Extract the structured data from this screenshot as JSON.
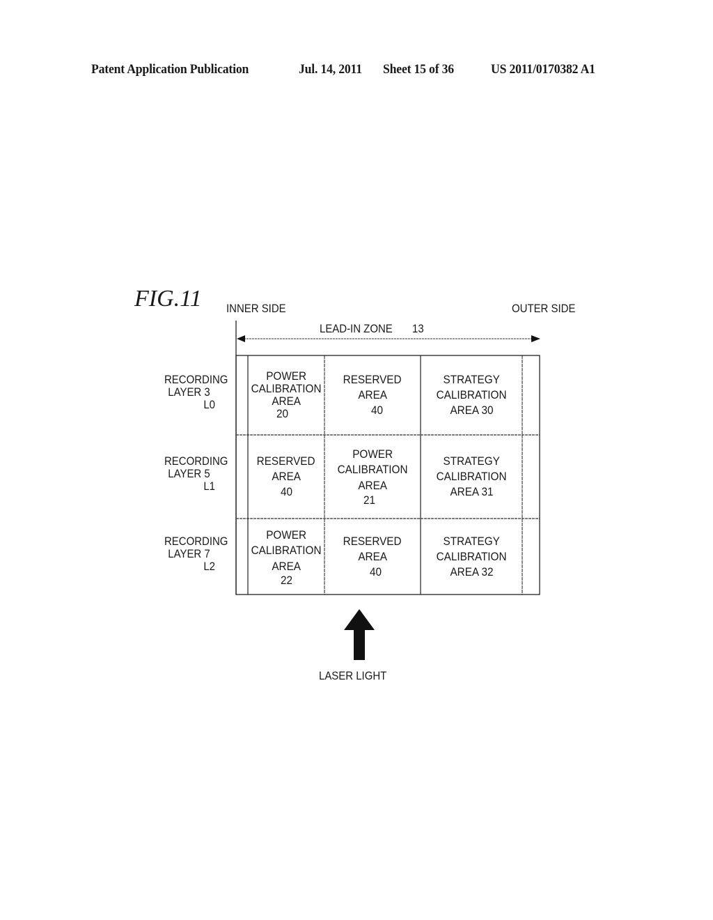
{
  "header": {
    "publication": "Patent Application Publication",
    "date": "Jul. 14, 2011",
    "sheet": "Sheet 15 of 36",
    "number": "US 2011/0170382 A1"
  },
  "figure": {
    "title": "FIG.11",
    "inner_side": "INNER SIDE",
    "outer_side": "OUTER SIDE",
    "lead_in_zone": "LEAD-IN ZONE",
    "lead_in_ref": "13",
    "laser_label": "LASER LIGHT",
    "laser_icon": "up-arrow-icon",
    "rows": [
      {
        "label": [
          "RECORDING",
          "LAYER 3",
          "L0"
        ],
        "cells": [
          [
            "POWER",
            "CALIBRATION",
            "AREA",
            "20"
          ],
          [
            "RESERVED",
            "AREA",
            "40"
          ],
          [
            "STRATEGY",
            "CALIBRATION",
            "AREA 30"
          ]
        ]
      },
      {
        "label": [
          "RECORDING",
          "LAYER 5",
          "L1"
        ],
        "cells": [
          [
            "RESERVED",
            "AREA",
            "40"
          ],
          [
            "POWER",
            "CALIBRATION",
            "AREA",
            "21"
          ],
          [
            "STRATEGY",
            "CALIBRATION",
            "AREA 31"
          ]
        ]
      },
      {
        "label": [
          "RECORDING",
          "LAYER 7",
          "L2"
        ],
        "cells": [
          [
            "POWER",
            "CALIBRATION",
            "AREA",
            "22"
          ],
          [
            "RESERVED",
            "AREA",
            "40"
          ],
          [
            "STRATEGY",
            "CALIBRATION",
            "AREA 32"
          ]
        ]
      }
    ]
  }
}
